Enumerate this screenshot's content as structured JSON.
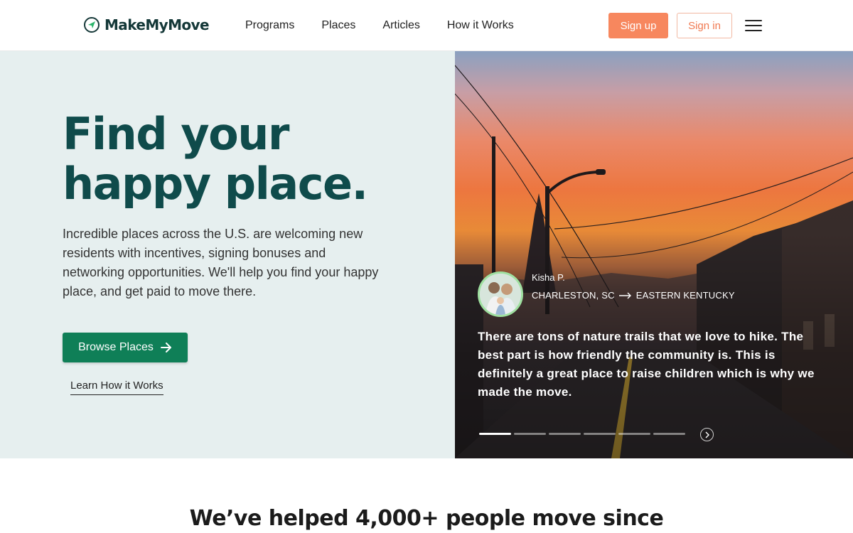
{
  "brand": {
    "name": "MakeMyMove",
    "icon": "compass-arrow-icon"
  },
  "nav": {
    "links": [
      {
        "label": "Programs"
      },
      {
        "label": "Places"
      },
      {
        "label": "Articles"
      },
      {
        "label": "How it Works"
      }
    ],
    "signup_label": "Sign up",
    "signin_label": "Sign in",
    "menu_icon": "hamburger-menu-icon"
  },
  "hero": {
    "title_line1": "Find your",
    "title_line2": "happy place.",
    "subtitle": "Incredible places across the U.S. are welcoming new residents with incentives, signing bonuses and networking opportunities. We'll help you find your happy place, and get paid to move there.",
    "browse_label": "Browse Places",
    "learn_label": "Learn How it Works"
  },
  "testimonial": {
    "name": "Kisha P.",
    "from": "CHARLESTON, SC",
    "to": "EASTERN KENTUCKY",
    "quote": "There are tons of nature trails that we love to hike. The best part is how friendly the community is. This is definitely a great place to raise children which is why we made the move.",
    "slide_count": 6,
    "active_slide": 1
  },
  "stats": {
    "heading": "We’ve helped 4,000+ people move since"
  },
  "colors": {
    "brand_dark": "#0f4b4b",
    "accent_orange": "#f7875e",
    "cta_green": "#0f7f57",
    "hero_bg": "#e6efef"
  }
}
